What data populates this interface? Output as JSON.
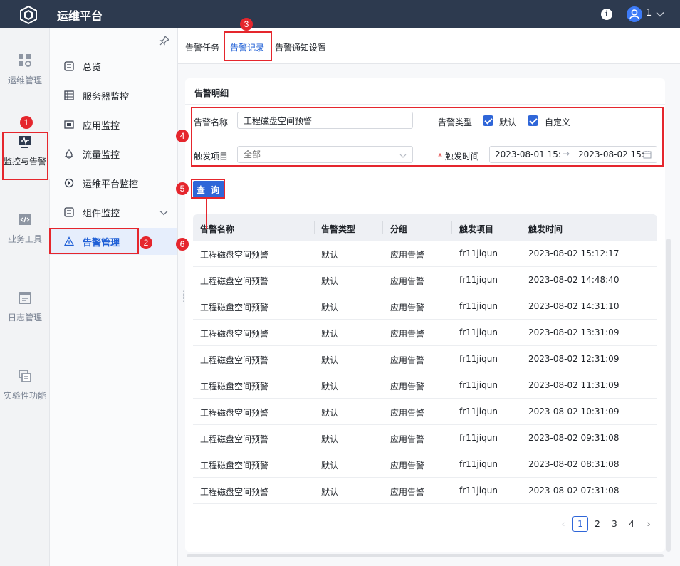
{
  "app": {
    "title": "运维平台",
    "user": "1"
  },
  "rail": [
    {
      "label": "运维管理",
      "icon": "grid-gear-icon"
    },
    {
      "label": "监控与告警",
      "icon": "monitor-icon"
    },
    {
      "label": "业务工具",
      "icon": "code-window-icon"
    },
    {
      "label": "日志管理",
      "icon": "calendar-log-icon"
    },
    {
      "label": "实验性功能",
      "icon": "layers-icon"
    }
  ],
  "subnav": [
    {
      "label": "总览",
      "icon": "overview-icon"
    },
    {
      "label": "服务器监控",
      "icon": "server-icon"
    },
    {
      "label": "应用监控",
      "icon": "app-icon"
    },
    {
      "label": "流量监控",
      "icon": "flow-icon"
    },
    {
      "label": "运维平台监控",
      "icon": "platform-icon"
    },
    {
      "label": "组件监控",
      "icon": "component-icon"
    },
    {
      "label": "告警管理",
      "icon": "alert-icon"
    }
  ],
  "tabs": [
    "告警任务",
    "告警记录",
    "告警通知设置"
  ],
  "card": {
    "title": "告警明细"
  },
  "filters": {
    "name_label": "告警名称",
    "name_value": "工程磁盘空间预警",
    "type_label": "告警类型",
    "type_options": [
      "默认",
      "自定义"
    ],
    "trigger_label": "触发项目",
    "trigger_placeholder": "全部",
    "time_required_mark": "*",
    "time_label": "触发时间",
    "time_start": "2023-08-01 15:",
    "time_end": "2023-08-02 15:"
  },
  "query_label": "查 询",
  "table": {
    "columns": [
      "告警名称",
      "告警类型",
      "分组",
      "触发项目",
      "触发时间"
    ],
    "rows": [
      [
        "工程磁盘空间预警",
        "默认",
        "应用告警",
        "fr11jiqun",
        "2023-08-02 15:12:17"
      ],
      [
        "工程磁盘空间预警",
        "默认",
        "应用告警",
        "fr11jiqun",
        "2023-08-02 14:48:40"
      ],
      [
        "工程磁盘空间预警",
        "默认",
        "应用告警",
        "fr11jiqun",
        "2023-08-02 14:31:10"
      ],
      [
        "工程磁盘空间预警",
        "默认",
        "应用告警",
        "fr11jiqun",
        "2023-08-02 13:31:09"
      ],
      [
        "工程磁盘空间预警",
        "默认",
        "应用告警",
        "fr11jiqun",
        "2023-08-02 12:31:09"
      ],
      [
        "工程磁盘空间预警",
        "默认",
        "应用告警",
        "fr11jiqun",
        "2023-08-02 11:31:09"
      ],
      [
        "工程磁盘空间预警",
        "默认",
        "应用告警",
        "fr11jiqun",
        "2023-08-02 10:31:09"
      ],
      [
        "工程磁盘空间预警",
        "默认",
        "应用告警",
        "fr11jiqun",
        "2023-08-02 09:31:08"
      ],
      [
        "工程磁盘空间预警",
        "默认",
        "应用告警",
        "fr11jiqun",
        "2023-08-02 08:31:08"
      ],
      [
        "工程磁盘空间预警",
        "默认",
        "应用告警",
        "fr11jiqun",
        "2023-08-02 07:31:08"
      ]
    ]
  },
  "pagination": {
    "prev": "‹",
    "next": "›",
    "pages": [
      "1",
      "2",
      "3",
      "4"
    ],
    "current": "1"
  },
  "annotations": [
    "1",
    "2",
    "3",
    "4",
    "5",
    "6"
  ],
  "colors": {
    "topbar": "#2d3a4f",
    "accent": "#2f66d8",
    "annotation": "#e5262d"
  }
}
